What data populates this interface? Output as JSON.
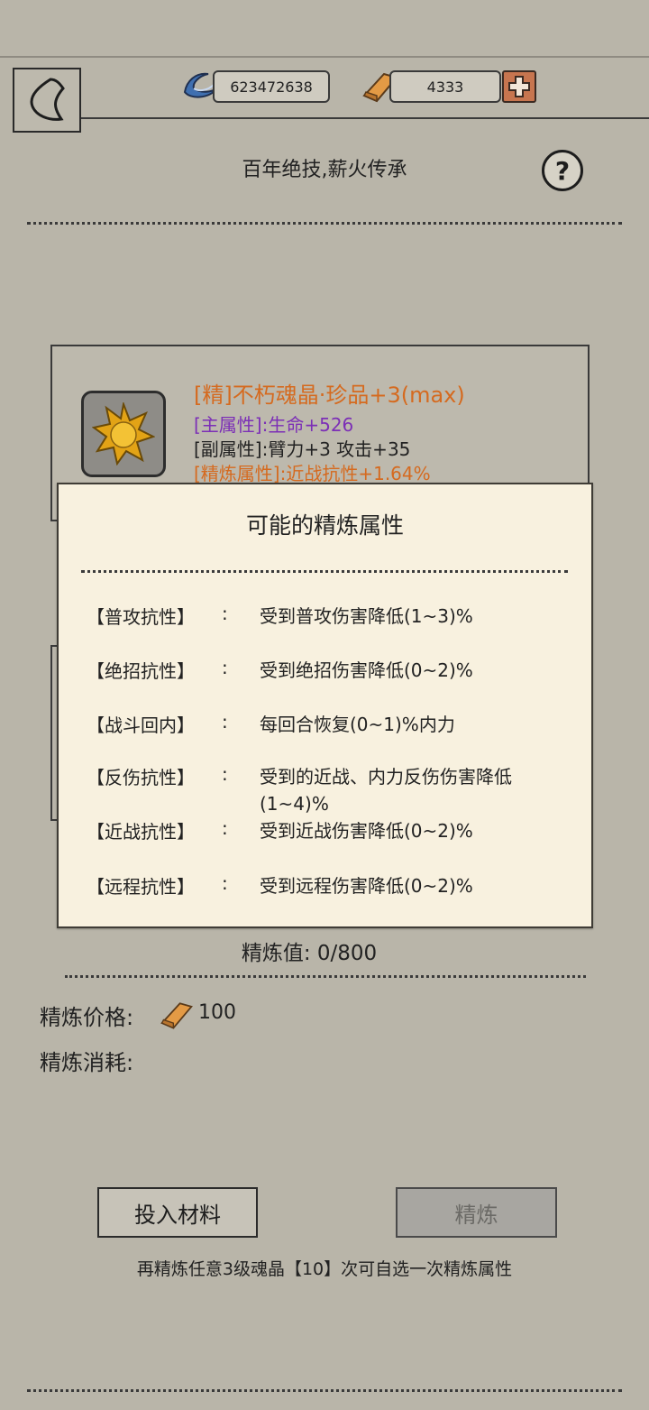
{
  "header": {
    "silver_amount": "623472638",
    "gold_amount": "4333",
    "title": "百年绝技,薪火传承",
    "help_symbol": "?"
  },
  "item": {
    "name": "[精]不朽魂晶·珍品+3(max)",
    "main_attr": "[主属性]:生命+526",
    "sub_attr": "[副属性]:臂力+3 攻击+35",
    "refine_attr": "[精炼属性]:近战抗性+1.64%"
  },
  "popup": {
    "title": "可能的精炼属性",
    "colon": ":",
    "properties": [
      {
        "name": "【普攻抗性】",
        "desc": "受到普攻伤害降低(1~3)%"
      },
      {
        "name": "【绝招抗性】",
        "desc": "受到绝招伤害降低(0~2)%"
      },
      {
        "name": "【战斗回内】",
        "desc": "每回合恢复(0~1)%内力"
      },
      {
        "name": "【反伤抗性】",
        "desc": "受到的近战、内力反伤伤害降低(1~4)%"
      },
      {
        "name": "【近战抗性】",
        "desc": "受到近战伤害降低(0~2)%"
      },
      {
        "name": "【远程抗性】",
        "desc": "受到远程伤害降低(0~2)%"
      }
    ]
  },
  "refine": {
    "value_text": "精炼值: 0/800",
    "price_label": "精炼价格:",
    "price_value": "100",
    "consume_label": "精炼消耗:"
  },
  "buttons": {
    "material_label": "投入材料",
    "refine_label": "精炼"
  },
  "hint": "再精炼任意3级魂晶【10】次可自选一次精炼属性",
  "colors": {
    "background": "#b9b5a9",
    "item_name": "#d56a1f",
    "main_attr": "#7c2fb6",
    "popup_bg": "#f8f1df"
  }
}
